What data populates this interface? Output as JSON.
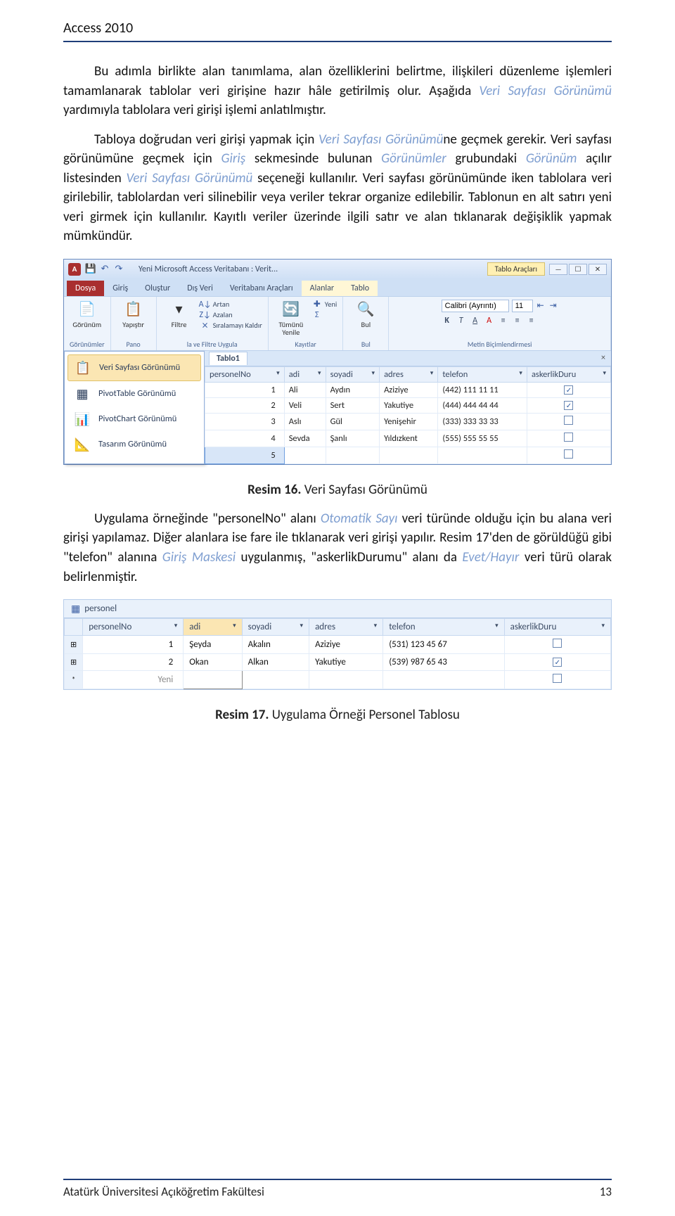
{
  "header": {
    "title": "Access 2010"
  },
  "text": {
    "p1a": "Bu adımla birlikte alan tanımlama, alan özelliklerini belirtme, ilişkileri düzenleme işlemleri tamamlanarak tablolar veri girişine hazır hâle getirilmiş olur. Aşağıda ",
    "p1b": " yardımıyla tablolara veri girişi işlemi anlatılmıştır.",
    "vsg": "Veri Sayfası Görünümü",
    "p2a": "Tabloya doğrudan veri girişi yapmak için ",
    "p2b": "ne geçmek gerekir. Veri sayfası görünümüne geçmek için ",
    "giris": "Giriş",
    "p2c": " sekmesinde bulunan ",
    "gorunumler": "Görünümler",
    "p2d": " grubundaki ",
    "gorunum": "Görünüm",
    "p2e": " açılır listesinden ",
    "p2f": " seçeneği kullanılır. Veri sayfası görünümünde iken tablolara veri girilebilir, tablolardan veri silinebilir veya veriler tekrar organize edilebilir. Tablonun en alt satırı yeni veri girmek için kullanılır. Kayıtlı veriler üzerinde ilgili satır ve alan tıklanarak değişiklik yapmak mümkündür.",
    "cap16b": "Resim 16.",
    "cap16t": " Veri Sayfası Görünümü",
    "p3a": "Uygulama örneğinde \"personelNo\" alanı ",
    "oto": "Otomatik Sayı",
    "p3b": " veri türünde olduğu için bu alana veri girişi yapılamaz. Diğer alanlara ise fare ile tıklanarak veri girişi yapılır. Resim 17'den de görüldüğü gibi \"telefon\" alanına ",
    "gm": "Giriş Maskesi",
    "p3c": " uygulanmış, \"askerlikDurumu\" alanı da ",
    "eh": "Evet/Hayır",
    "p3d": " veri türü olarak belirlenmiştir.",
    "cap17b": "Resim 17.",
    "cap17t": " Uygulama Örneği Personel Tablosu"
  },
  "footer": {
    "left": "Atatürk Üniversitesi Açıköğretim Fakültesi",
    "right": "13"
  },
  "ribbon": {
    "title": "Yeni Microsoft Access Veritabanı : Verit...",
    "context": "Tablo Araçları",
    "tabs": {
      "file": "Dosya",
      "home": "Giriş",
      "create": "Oluştur",
      "ext": "Dış Veri",
      "db": "Veritabanı Araçları",
      "fields": "Alanlar",
      "table": "Tablo"
    },
    "groups": {
      "views": "Görünümler",
      "clipboard": "Pano",
      "sort": "la ve Filtre Uygula",
      "records": "Kayıtlar",
      "find": "Bul",
      "text": "Metin Biçimlendirmesi"
    },
    "btn": {
      "view": "Görünüm",
      "paste": "Yapıştır",
      "filter": "Filtre",
      "asc": "Artan",
      "desc": "Azalan",
      "clear": "Sıralamayı Kaldır",
      "refresh": "Tümünü\nYenile",
      "new": "Yeni",
      "totals": "Σ",
      "find": "Bul",
      "font": "Calibri (Ayrıntı)",
      "size": "11"
    },
    "views_menu": [
      "Veri Sayfası Görünümü",
      "PivotTable Görünümü",
      "PivotChart Görünümü",
      "Tasarım Görünümü"
    ]
  },
  "table1": {
    "name": "Tablo1",
    "cols": [
      "personelNo",
      "adi",
      "soyadi",
      "adres",
      "telefon",
      "askerlikDuru"
    ],
    "rows": [
      {
        "no": "1",
        "adi": "Ali",
        "soyadi": "Aydın",
        "adres": "Aziziye",
        "tel": "(442) 111 11 11",
        "ask": true
      },
      {
        "no": "2",
        "adi": "Veli",
        "soyadi": "Sert",
        "adres": "Yakutiye",
        "tel": "(444) 444 44 44",
        "ask": true
      },
      {
        "no": "3",
        "adi": "Aslı",
        "soyadi": "Gül",
        "adres": "Yenişehir",
        "tel": "(333) 333 33 33",
        "ask": false
      },
      {
        "no": "4",
        "adi": "Sevda",
        "soyadi": "Şanlı",
        "adres": "Yıldızkent",
        "tel": "(555) 555 55 55",
        "ask": false
      }
    ],
    "newNo": "5"
  },
  "table2": {
    "name": "personel",
    "cols": [
      "personelNo",
      "adi",
      "soyadi",
      "adres",
      "telefon",
      "askerlikDuru"
    ],
    "rows": [
      {
        "no": "1",
        "adi": "Şeyda",
        "soyadi": "Akalın",
        "adres": "Aziziye",
        "tel": "(531) 123 45 67",
        "ask": false
      },
      {
        "no": "2",
        "adi": "Okan",
        "soyadi": "Alkan",
        "adres": "Yakutiye",
        "tel": "(539) 987 65 43",
        "ask": true
      }
    ],
    "newLabel": "Yeni"
  }
}
